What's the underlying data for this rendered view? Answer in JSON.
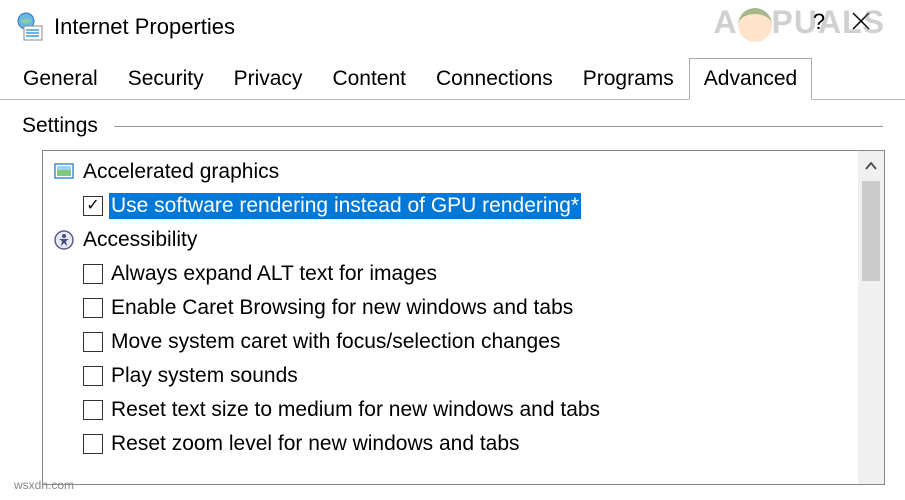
{
  "window": {
    "title": "Internet Properties",
    "help_label": "?",
    "close_label": "✕"
  },
  "watermark": "A  PUALS",
  "tabs": [
    {
      "label": "General",
      "active": false
    },
    {
      "label": "Security",
      "active": false
    },
    {
      "label": "Privacy",
      "active": false
    },
    {
      "label": "Content",
      "active": false
    },
    {
      "label": "Connections",
      "active": false
    },
    {
      "label": "Programs",
      "active": false
    },
    {
      "label": "Advanced",
      "active": true
    }
  ],
  "settings": {
    "header": "Settings",
    "groups": [
      {
        "icon": "graphics-icon",
        "label": "Accelerated graphics",
        "items": [
          {
            "checked": true,
            "selected": true,
            "label": "Use software rendering instead of GPU rendering*"
          }
        ]
      },
      {
        "icon": "accessibility-icon",
        "label": "Accessibility",
        "items": [
          {
            "checked": false,
            "selected": false,
            "label": "Always expand ALT text for images"
          },
          {
            "checked": false,
            "selected": false,
            "label": "Enable Caret Browsing for new windows and tabs"
          },
          {
            "checked": false,
            "selected": false,
            "label": "Move system caret with focus/selection changes"
          },
          {
            "checked": false,
            "selected": false,
            "label": "Play system sounds"
          },
          {
            "checked": false,
            "selected": false,
            "label": "Reset text size to medium for new windows and tabs"
          },
          {
            "checked": false,
            "selected": false,
            "label": "Reset zoom level for new windows and tabs"
          }
        ]
      }
    ]
  },
  "footer": "wsxdn.com"
}
